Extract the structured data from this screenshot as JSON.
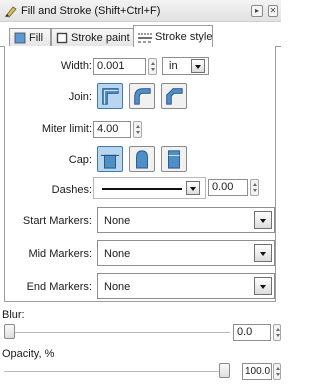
{
  "window": {
    "title": "Fill and Stroke (Shift+Ctrl+F)",
    "menu_button_label": "▸",
    "close_button_label": "✕"
  },
  "tabs": [
    {
      "label": "Fill",
      "icon": "fill-icon",
      "active": false
    },
    {
      "label": "Stroke paint",
      "icon": "stroke-paint-icon",
      "active": false
    },
    {
      "label": "Stroke style",
      "icon": "stroke-style-icon",
      "active": true
    }
  ],
  "stroke_style": {
    "width_label": "Width:",
    "width_value": "0.001",
    "width_unit": "in",
    "join_label": "Join:",
    "join_buttons": [
      {
        "icon": "miter-join-icon",
        "pressed": true
      },
      {
        "icon": "round-join-icon",
        "pressed": false
      },
      {
        "icon": "bevel-join-icon",
        "pressed": false
      }
    ],
    "miter_label": "Miter limit:",
    "miter_value": "4.00",
    "cap_label": "Cap:",
    "cap_buttons": [
      {
        "icon": "butt-cap-icon",
        "pressed": true
      },
      {
        "icon": "round-cap-icon",
        "pressed": false
      },
      {
        "icon": "square-cap-icon",
        "pressed": false
      }
    ],
    "dashes_label": "Dashes:",
    "dash_offset": "0.00",
    "start_markers_label": "Start Markers:",
    "start_markers_value": "None",
    "mid_markers_label": "Mid Markers:",
    "mid_markers_value": "None",
    "end_markers_label": "End Markers:",
    "end_markers_value": "None"
  },
  "blur": {
    "label": "Blur:",
    "value": "0.0",
    "level": 0
  },
  "opacity": {
    "label": "Opacity, %",
    "value": "100.0",
    "level": 100
  },
  "colors": {
    "accent": "#3d7ab3",
    "pressed_fill": "#b9d6ee"
  }
}
